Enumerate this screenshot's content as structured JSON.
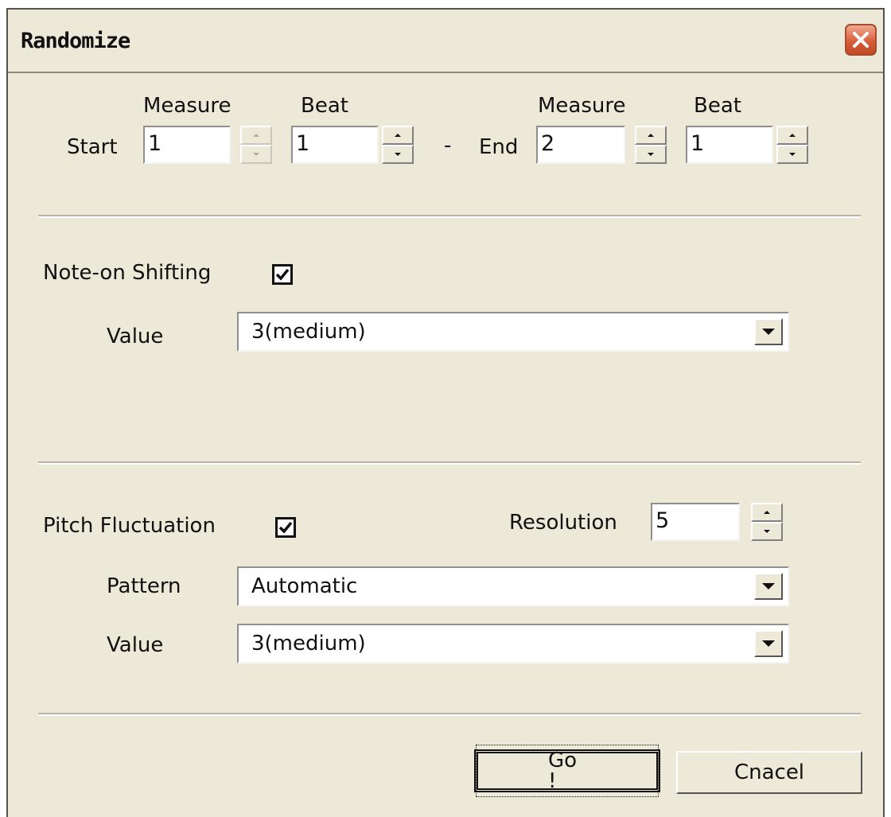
{
  "window": {
    "title": "Randomize"
  },
  "range": {
    "start_label": "Start",
    "end_label": "End",
    "dash": "-",
    "measure_header": "Measure",
    "beat_header": "Beat",
    "start_measure": "1",
    "start_beat": "1",
    "end_measure": "2",
    "end_beat": "1"
  },
  "note_on": {
    "label": "Note-on Shifting",
    "checked": true,
    "value_label": "Value",
    "value": "3(medium)"
  },
  "pitch": {
    "label": "Pitch Fluctuation",
    "checked": true,
    "resolution_label": "Resolution",
    "resolution": "5",
    "pattern_label": "Pattern",
    "pattern": "Automatic",
    "value_label": "Value",
    "value": "3(medium)"
  },
  "buttons": {
    "go": "Go !",
    "cancel": "Cnacel"
  },
  "colors": {
    "dialog_bg": "#ece9d8",
    "close_button": "#d65a36"
  },
  "icons": {
    "close": "close-x-icon",
    "checkbox": "checkmark-icon",
    "dropdown": "dropdown-arrow-icon",
    "spinner": "spinner-arrows-icon"
  }
}
